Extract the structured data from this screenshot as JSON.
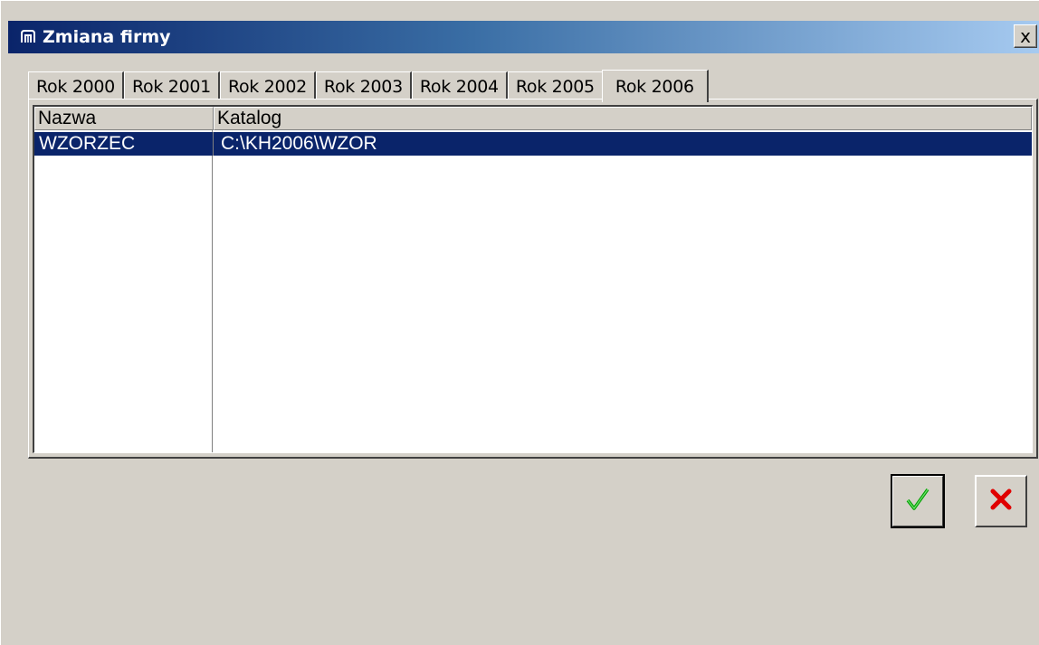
{
  "window": {
    "title": "Zmiana firmy",
    "close_label": "x",
    "icon": "app-logo-icon"
  },
  "tabs": [
    {
      "label": "Rok 2000",
      "active": false
    },
    {
      "label": "Rok 2001",
      "active": false
    },
    {
      "label": "Rok 2002",
      "active": false
    },
    {
      "label": "Rok 2003",
      "active": false
    },
    {
      "label": "Rok 2004",
      "active": false
    },
    {
      "label": "Rok 2005",
      "active": false
    },
    {
      "label": "Rok 2006",
      "active": true
    }
  ],
  "list": {
    "columns": [
      "Nazwa",
      "Katalog"
    ],
    "rows": [
      {
        "nazwa": "WZORZEC",
        "katalog": "C:\\KH2006\\WZOR",
        "selected": true
      }
    ],
    "selection_color": "#0a246a"
  },
  "buttons": {
    "ok_icon": "checkmark-icon",
    "cancel_icon": "cross-icon",
    "ok_color": "#00a000",
    "cancel_color": "#e00000"
  }
}
